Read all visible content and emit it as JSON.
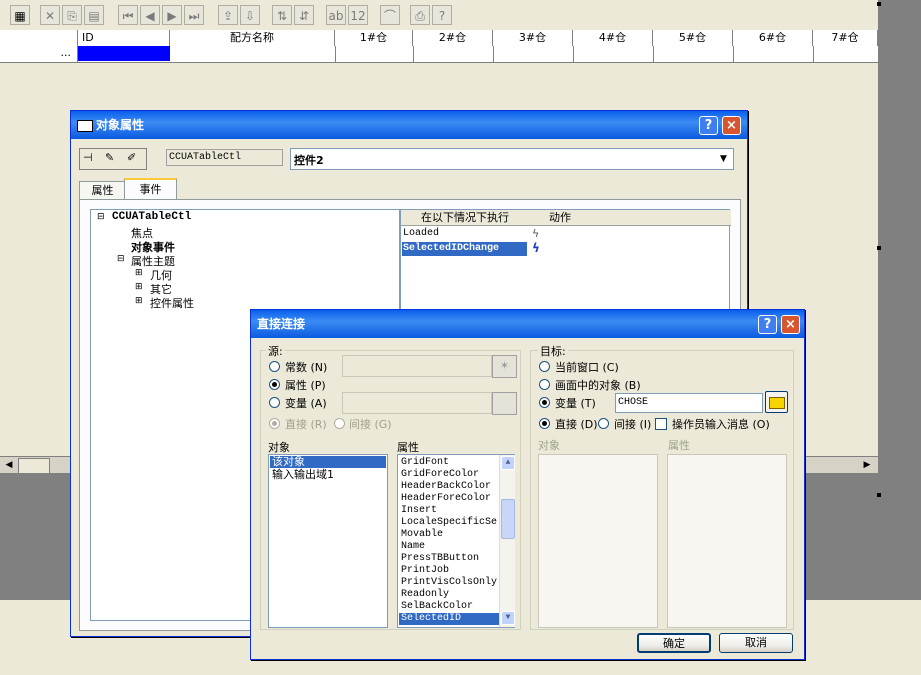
{
  "grid": {
    "columns": [
      "ID",
      "配方名称",
      "1#仓",
      "2#仓",
      "3#仓",
      "4#仓",
      "5#仓",
      "6#仓",
      "7#仓"
    ],
    "row_indicator": "..."
  },
  "props_dialog": {
    "title": "对象属性",
    "help_glyph": "?",
    "close_glyph": "×",
    "object_type": "CCUATableCtl",
    "object_name": "控件2",
    "tabs": [
      "属性",
      "事件"
    ],
    "tree": {
      "root": "CCUATableCtl",
      "items": [
        "焦点",
        "对象事件",
        "属性主题"
      ],
      "subitems": [
        "几何",
        "其它",
        "控件属性"
      ]
    },
    "events_header": {
      "col1": "在以下情况下执行",
      "col2": "动作"
    },
    "events": [
      "Loaded",
      "SelectedIDChange"
    ]
  },
  "direct_dialog": {
    "title": "直接连接",
    "source_group": "源:",
    "source_options": [
      "常数 (N)",
      "属性 (P)",
      "变量 (A)"
    ],
    "source_sub": [
      "直接 (R)",
      "间接 (G)"
    ],
    "object_label": "对象",
    "property_label": "属性",
    "objects": [
      "该对象",
      "输入输出域1"
    ],
    "properties": [
      "GridFont",
      "GridForeColor",
      "HeaderBackColor",
      "HeaderForeColor",
      "Insert",
      "LocaleSpecificSe",
      "Movable",
      "Name",
      "PressTBButton",
      "PrintJob",
      "PrintVisColsOnly",
      "Readonly",
      "SelBackColor",
      "SelectedID"
    ],
    "target_group": "目标:",
    "target_options": [
      "当前窗口 (C)",
      "画面中的对象 (B)",
      "变量 (T)"
    ],
    "target_variable": "CHOSE",
    "target_sub": [
      "直接 (D)",
      "间接 (I)"
    ],
    "operator_msg": "操作员输入消息 (O)",
    "target_object_label": "对象",
    "target_property_label": "属性",
    "ok": "确定",
    "cancel": "取消"
  }
}
